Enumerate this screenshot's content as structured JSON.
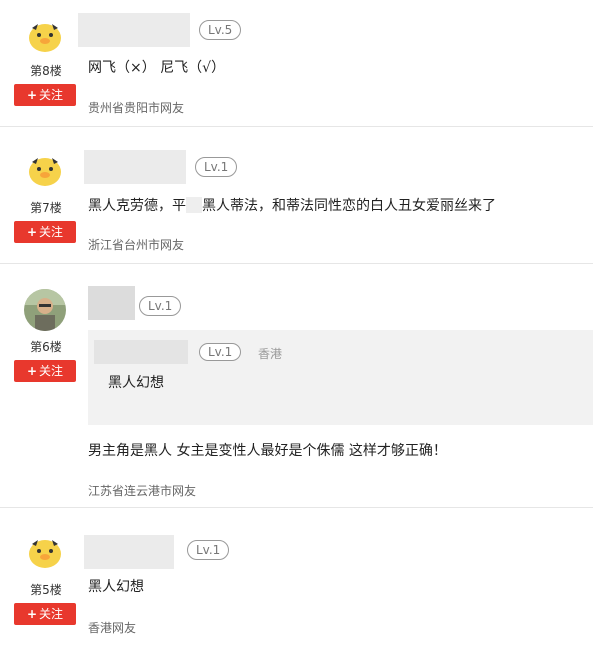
{
  "posts": [
    {
      "floor": "第8楼",
      "follow": "关注",
      "level": "Lv.5",
      "content": "网飞（×） 尼飞（√）",
      "location": "贵州省贵阳市网友",
      "avatar": "chick-avatar"
    },
    {
      "floor": "第7楼",
      "follow": "关注",
      "level": "Lv.1",
      "content_a": "黑人克劳德，平",
      "content_b": "黑人蒂法，和蒂法同性恋的白人丑女爱丽丝来了",
      "location": "浙江省台州市网友",
      "avatar": "photo-avatar"
    },
    {
      "floor": "第6楼",
      "follow": "关注",
      "level": "Lv.1",
      "quote": {
        "level": "Lv.1",
        "place": "香港",
        "text": "黑人幻想"
      },
      "content": "男主角是黑人 女主是变性人最好是个侏儒 这样才够正确！",
      "location": "江苏省连云港市网友",
      "avatar": "photo-avatar"
    },
    {
      "floor": "第5楼",
      "follow": "关注",
      "level": "Lv.1",
      "content": "黑人幻想",
      "location": "香港网友",
      "avatar": "chick-avatar"
    }
  ],
  "colors": {
    "follow_button": "#e8382d",
    "divider": "#e6e6e6",
    "quote_bg": "#f2f2f2"
  }
}
